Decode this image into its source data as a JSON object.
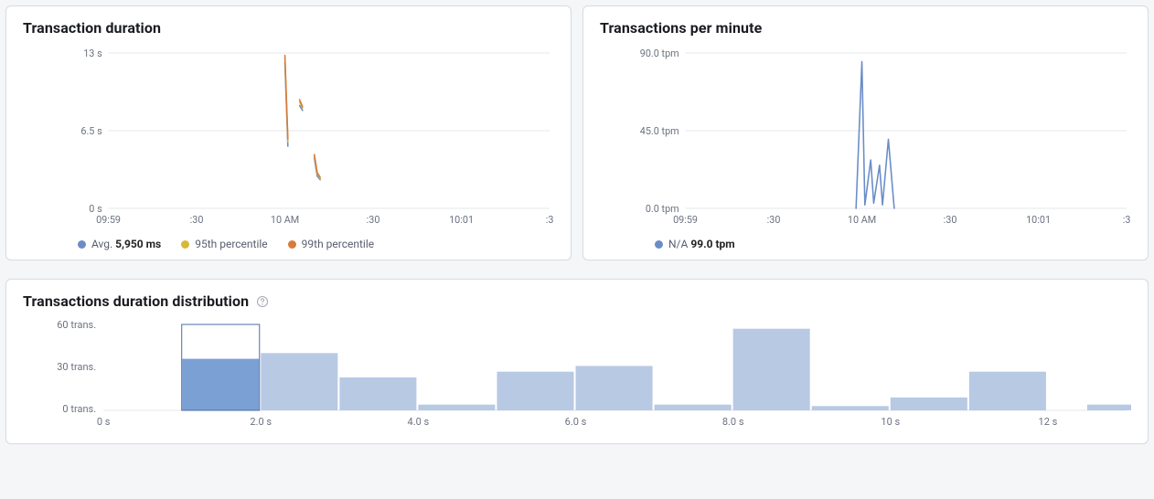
{
  "panels": {
    "duration": {
      "title": "Transaction duration",
      "y_ticks": [
        "0 s",
        "6.5 s",
        "13 s"
      ],
      "x_ticks": [
        "09:59",
        ":30",
        "10 AM",
        ":30",
        "10:01",
        ":3"
      ],
      "legend": [
        {
          "color": "#6a8dc8",
          "label": "Avg.",
          "value": "5,950 ms"
        },
        {
          "color": "#d6b93a",
          "label": "95th percentile",
          "value": ""
        },
        {
          "color": "#d87b3c",
          "label": "99th percentile",
          "value": ""
        }
      ]
    },
    "tpm": {
      "title": "Transactions per minute",
      "y_ticks": [
        "0.0 tpm",
        "45.0 tpm",
        "90.0 tpm"
      ],
      "x_ticks": [
        "09:59",
        ":30",
        "10 AM",
        ":30",
        "10:01",
        ":3"
      ],
      "legend": [
        {
          "color": "#6a8dc8",
          "label": "N/A",
          "value": "99.0 tpm"
        }
      ]
    },
    "hist": {
      "title": "Transactions duration distribution",
      "y_ticks": [
        "0 trans.",
        "30 trans.",
        "60 trans."
      ],
      "x_ticks": [
        "0 s",
        "2.0 s",
        "4.0 s",
        "6.0 s",
        "8.0 s",
        "10 s",
        "12 s"
      ]
    }
  },
  "chart_data": [
    {
      "id": "transaction_duration",
      "type": "line",
      "title": "Transaction duration",
      "xlabel": "",
      "ylabel": "",
      "x_axis_ticks": [
        "09:59",
        ":30",
        "10 AM",
        ":30",
        "10:01",
        ":3"
      ],
      "ylim": [
        0,
        13
      ],
      "y_unit": "s",
      "series": [
        {
          "name": "Avg.",
          "color": "#6a8dc8",
          "points": [
            {
              "x": "10:00:00",
              "y": 12.2
            },
            {
              "x": "10:00:01",
              "y": 5.2
            },
            {
              "x": "10:00:05",
              "y": 8.6
            },
            {
              "x": "10:00:06",
              "y": 8.2
            },
            {
              "x": "10:00:10",
              "y": 4.2
            },
            {
              "x": "10:00:11",
              "y": 2.7
            },
            {
              "x": "10:00:12",
              "y": 2.4
            }
          ]
        },
        {
          "name": "95th percentile",
          "color": "#d6b93a",
          "points": [
            {
              "x": "10:00:00",
              "y": 12.6
            },
            {
              "x": "10:00:01",
              "y": 5.6
            },
            {
              "x": "10:00:05",
              "y": 8.9
            },
            {
              "x": "10:00:06",
              "y": 8.4
            },
            {
              "x": "10:00:10",
              "y": 4.4
            },
            {
              "x": "10:00:11",
              "y": 2.9
            },
            {
              "x": "10:00:12",
              "y": 2.5
            }
          ]
        },
        {
          "name": "99th percentile",
          "color": "#d87b3c",
          "points": [
            {
              "x": "10:00:00",
              "y": 12.8
            },
            {
              "x": "10:00:01",
              "y": 5.8
            },
            {
              "x": "10:00:05",
              "y": 9.1
            },
            {
              "x": "10:00:06",
              "y": 8.5
            },
            {
              "x": "10:00:10",
              "y": 4.5
            },
            {
              "x": "10:00:11",
              "y": 3.0
            },
            {
              "x": "10:00:12",
              "y": 2.6
            }
          ]
        }
      ],
      "legend_values": {
        "Avg.": "5,950 ms"
      }
    },
    {
      "id": "transactions_per_minute",
      "type": "line",
      "title": "Transactions per minute",
      "x_axis_ticks": [
        "09:59",
        ":30",
        "10 AM",
        ":30",
        "10:01",
        ":3"
      ],
      "ylim": [
        0,
        90
      ],
      "y_unit": "tpm",
      "series": [
        {
          "name": "N/A",
          "color": "#6a8dc8",
          "points": [
            {
              "x": "09:59:00",
              "y": 0
            },
            {
              "x": "09:59:58",
              "y": 0
            },
            {
              "x": "10:00:00",
              "y": 85
            },
            {
              "x": "10:00:01",
              "y": 2
            },
            {
              "x": "10:00:03",
              "y": 28
            },
            {
              "x": "10:00:04",
              "y": 3
            },
            {
              "x": "10:00:06",
              "y": 25
            },
            {
              "x": "10:00:07",
              "y": 2
            },
            {
              "x": "10:00:09",
              "y": 40
            },
            {
              "x": "10:00:11",
              "y": 0
            },
            {
              "x": "10:01:30",
              "y": 0
            }
          ]
        }
      ],
      "legend_values": {
        "N/A": "99.0 tpm"
      }
    },
    {
      "id": "transactions_duration_distribution",
      "type": "bar",
      "title": "Transactions duration distribution",
      "xlabel": "",
      "ylabel": "",
      "y_unit": "trans.",
      "ylim": [
        0,
        60
      ],
      "x_unit": "s",
      "categories": [
        1.0,
        1.5,
        2.0,
        2.5,
        3.0,
        3.5,
        4.0,
        4.5,
        5.0,
        5.5,
        6.0,
        6.5,
        7.0,
        7.5,
        8.0,
        8.5,
        9.0,
        9.5,
        10.0,
        10.5,
        11.0,
        11.5,
        12.0,
        12.5
      ],
      "values": [
        36,
        0,
        40,
        0,
        23,
        0,
        4,
        0,
        27,
        0,
        31,
        0,
        4,
        0,
        57,
        0,
        3,
        0,
        9,
        0,
        27,
        0,
        0,
        4
      ],
      "selected_bucket": 1.0,
      "selected_envelope_value": 60,
      "x_axis_ticks": [
        "0 s",
        "2.0 s",
        "4.0 s",
        "6.0 s",
        "8.0 s",
        "10 s",
        "12 s"
      ]
    }
  ]
}
